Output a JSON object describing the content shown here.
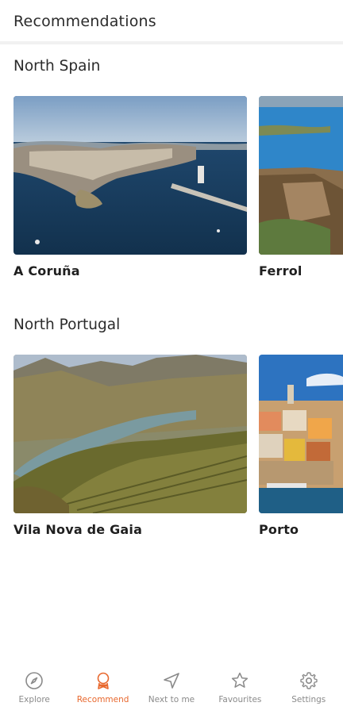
{
  "header": {
    "title": "Recommendations"
  },
  "sections": [
    {
      "title": "North Spain",
      "cards": [
        {
          "label": "A Coruña"
        },
        {
          "label": "Ferrol"
        }
      ]
    },
    {
      "title": "North Portugal",
      "cards": [
        {
          "label": "Vila Nova de Gaia"
        },
        {
          "label": "Porto"
        }
      ]
    }
  ],
  "bottom_nav": {
    "items": [
      {
        "label": "Explore",
        "icon": "compass-icon",
        "active": false
      },
      {
        "label": "Recommend",
        "icon": "ribbon-badge-icon",
        "active": true
      },
      {
        "label": "Next to me",
        "icon": "navigation-arrow-icon",
        "active": false
      },
      {
        "label": "Favourites",
        "icon": "star-icon",
        "active": false
      },
      {
        "label": "Settings",
        "icon": "gear-icon",
        "active": false
      }
    ],
    "active_color": "#e8682e",
    "inactive_color": "#8a8a8a"
  }
}
